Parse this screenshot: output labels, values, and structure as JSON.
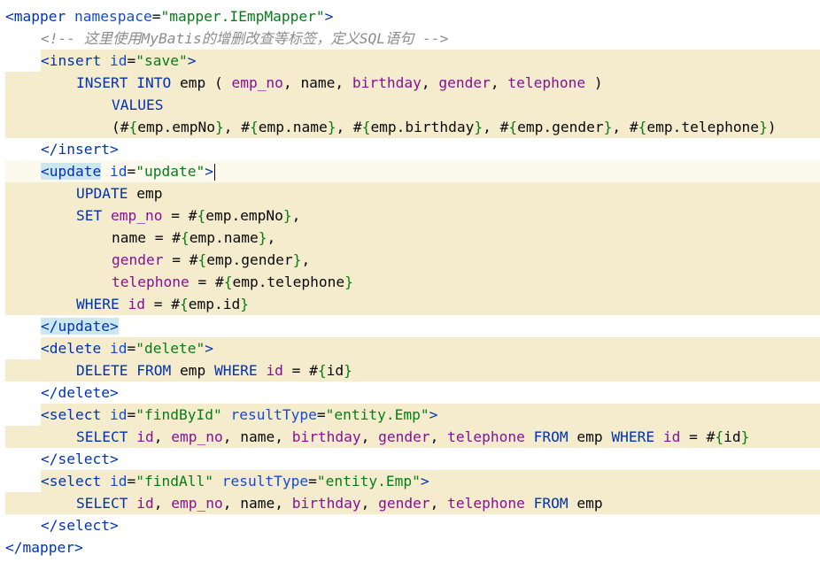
{
  "editor": {
    "lines": [
      {
        "indent": 0,
        "tokens": [
          {
            "t": "<",
            "c": "c-tag"
          },
          {
            "t": "mapper",
            "c": "c-tag"
          },
          {
            "t": " "
          },
          {
            "t": "namespace",
            "c": "c-attr"
          },
          {
            "t": "=",
            "c": "c-op"
          },
          {
            "t": "\"mapper.IEmpMapper\"",
            "c": "c-str"
          },
          {
            "t": ">",
            "c": "c-tag"
          }
        ],
        "bg": "none"
      },
      {
        "indent": 1,
        "tokens": [
          {
            "t": "<!-- 这里使用MyBatis的增删改查等标签，定义SQL语句 -->",
            "c": "c-cmt"
          }
        ],
        "bg": "none"
      },
      {
        "indent": 1,
        "tokens": [
          {
            "t": "<",
            "c": "c-tag"
          },
          {
            "t": "insert",
            "c": "c-tag"
          },
          {
            "t": " "
          },
          {
            "t": "id",
            "c": "c-attr"
          },
          {
            "t": "=",
            "c": "c-op"
          },
          {
            "t": "\"save\"",
            "c": "c-str"
          },
          {
            "t": ">",
            "c": "c-tag"
          }
        ],
        "bg": "hl",
        "bgFrom": 1
      },
      {
        "indent": 2,
        "tokens": [
          {
            "t": "INSERT INTO ",
            "c": "c-kw"
          },
          {
            "t": "emp",
            "c": "c-txt"
          },
          {
            "t": " ( ",
            "c": "c-op"
          },
          {
            "t": "emp_no",
            "c": "c-col"
          },
          {
            "t": ", ",
            "c": "c-op"
          },
          {
            "t": "name",
            "c": "c-txt"
          },
          {
            "t": ", ",
            "c": "c-op"
          },
          {
            "t": "birthday",
            "c": "c-col"
          },
          {
            "t": ", ",
            "c": "c-op"
          },
          {
            "t": "gender",
            "c": "c-col"
          },
          {
            "t": ", ",
            "c": "c-op"
          },
          {
            "t": "telephone",
            "c": "c-col"
          },
          {
            "t": " )",
            "c": "c-op"
          }
        ],
        "bg": "hl",
        "bgFrom": 0
      },
      {
        "indent": 3,
        "tokens": [
          {
            "t": "VALUES",
            "c": "c-kw"
          }
        ],
        "bg": "hl",
        "bgFrom": 0
      },
      {
        "indent": 3,
        "tokens": [
          {
            "t": "(#",
            "c": "c-op"
          },
          {
            "t": "{",
            "c": "c-brace"
          },
          {
            "t": "emp.empNo",
            "c": "c-txt"
          },
          {
            "t": "}",
            "c": "c-brace"
          },
          {
            "t": ", #",
            "c": "c-op"
          },
          {
            "t": "{",
            "c": "c-brace"
          },
          {
            "t": "emp.name",
            "c": "c-txt"
          },
          {
            "t": "}",
            "c": "c-brace"
          },
          {
            "t": ", #",
            "c": "c-op"
          },
          {
            "t": "{",
            "c": "c-brace"
          },
          {
            "t": "emp.birthday",
            "c": "c-txt"
          },
          {
            "t": "}",
            "c": "c-brace"
          },
          {
            "t": ", #",
            "c": "c-op"
          },
          {
            "t": "{",
            "c": "c-brace"
          },
          {
            "t": "emp.gender",
            "c": "c-txt"
          },
          {
            "t": "}",
            "c": "c-brace"
          },
          {
            "t": ", #",
            "c": "c-op"
          },
          {
            "t": "{",
            "c": "c-brace"
          },
          {
            "t": "emp.telephone",
            "c": "c-txt"
          },
          {
            "t": "}",
            "c": "c-brace"
          },
          {
            "t": ")",
            "c": "c-op"
          }
        ],
        "bg": "hl",
        "bgFrom": 0
      },
      {
        "indent": 1,
        "tokens": [
          {
            "t": "</",
            "c": "c-tag"
          },
          {
            "t": "insert",
            "c": "c-tag"
          },
          {
            "t": ">",
            "c": "c-tag"
          }
        ],
        "bg": "none"
      },
      {
        "indent": 1,
        "tokens": [
          {
            "t": "<",
            "c": "c-tag c-tagmatch"
          },
          {
            "t": "update",
            "c": "c-tag c-tagmatch"
          },
          {
            "t": " "
          },
          {
            "t": "id",
            "c": "c-attr"
          },
          {
            "t": "=",
            "c": "c-op"
          },
          {
            "t": "\"update\"",
            "c": "c-str"
          },
          {
            "t": ">",
            "c": "c-tag"
          }
        ],
        "bg": "cur",
        "caret": true
      },
      {
        "indent": 2,
        "tokens": [
          {
            "t": "UPDATE ",
            "c": "c-kw"
          },
          {
            "t": "emp",
            "c": "c-txt"
          }
        ],
        "bg": "hl",
        "bgFrom": 0
      },
      {
        "indent": 2,
        "tokens": [
          {
            "t": "SET ",
            "c": "c-kw"
          },
          {
            "t": "emp_no",
            "c": "c-col"
          },
          {
            "t": " = #",
            "c": "c-op"
          },
          {
            "t": "{",
            "c": "c-brace"
          },
          {
            "t": "emp.empNo",
            "c": "c-txt"
          },
          {
            "t": "}",
            "c": "c-brace"
          },
          {
            "t": ",",
            "c": "c-op"
          }
        ],
        "bg": "hl",
        "bgFrom": 0
      },
      {
        "indent": 3,
        "tokens": [
          {
            "t": "name",
            "c": "c-txt"
          },
          {
            "t": " = #",
            "c": "c-op"
          },
          {
            "t": "{",
            "c": "c-brace"
          },
          {
            "t": "emp.name",
            "c": "c-txt"
          },
          {
            "t": "}",
            "c": "c-brace"
          },
          {
            "t": ",",
            "c": "c-op"
          }
        ],
        "bg": "hl",
        "bgFrom": 0
      },
      {
        "indent": 3,
        "tokens": [
          {
            "t": "gender",
            "c": "c-col"
          },
          {
            "t": " = #",
            "c": "c-op"
          },
          {
            "t": "{",
            "c": "c-brace"
          },
          {
            "t": "emp.gender",
            "c": "c-txt"
          },
          {
            "t": "}",
            "c": "c-brace"
          },
          {
            "t": ",",
            "c": "c-op"
          }
        ],
        "bg": "hl",
        "bgFrom": 0
      },
      {
        "indent": 3,
        "tokens": [
          {
            "t": "telephone",
            "c": "c-col"
          },
          {
            "t": " = #",
            "c": "c-op"
          },
          {
            "t": "{",
            "c": "c-brace"
          },
          {
            "t": "emp.telephone",
            "c": "c-txt"
          },
          {
            "t": "}",
            "c": "c-brace"
          }
        ],
        "bg": "hl",
        "bgFrom": 0
      },
      {
        "indent": 2,
        "tokens": [
          {
            "t": "WHERE ",
            "c": "c-kw"
          },
          {
            "t": "id",
            "c": "c-col"
          },
          {
            "t": " = #",
            "c": "c-op"
          },
          {
            "t": "{",
            "c": "c-brace"
          },
          {
            "t": "emp.id",
            "c": "c-txt"
          },
          {
            "t": "}",
            "c": "c-brace"
          }
        ],
        "bg": "hl",
        "bgFrom": 0
      },
      {
        "indent": 1,
        "tokens": [
          {
            "t": "</",
            "c": "c-tag c-tagmatch"
          },
          {
            "t": "update",
            "c": "c-tag c-tagmatch"
          },
          {
            "t": ">",
            "c": "c-tag c-tagmatch"
          }
        ],
        "bg": "none"
      },
      {
        "indent": 1,
        "tokens": [
          {
            "t": "<",
            "c": "c-tag"
          },
          {
            "t": "delete",
            "c": "c-tag"
          },
          {
            "t": " "
          },
          {
            "t": "id",
            "c": "c-attr"
          },
          {
            "t": "=",
            "c": "c-op"
          },
          {
            "t": "\"delete\"",
            "c": "c-str"
          },
          {
            "t": ">",
            "c": "c-tag"
          }
        ],
        "bg": "hl",
        "bgFrom": 1
      },
      {
        "indent": 2,
        "tokens": [
          {
            "t": "DELETE FROM ",
            "c": "c-kw"
          },
          {
            "t": "emp",
            "c": "c-txt"
          },
          {
            "t": " WHERE ",
            "c": "c-kw"
          },
          {
            "t": "id",
            "c": "c-col"
          },
          {
            "t": " = #",
            "c": "c-op"
          },
          {
            "t": "{",
            "c": "c-brace"
          },
          {
            "t": "id",
            "c": "c-txt"
          },
          {
            "t": "}",
            "c": "c-brace"
          }
        ],
        "bg": "hl",
        "bgFrom": 0
      },
      {
        "indent": 1,
        "tokens": [
          {
            "t": "</",
            "c": "c-tag"
          },
          {
            "t": "delete",
            "c": "c-tag"
          },
          {
            "t": ">",
            "c": "c-tag"
          }
        ],
        "bg": "none"
      },
      {
        "indent": 1,
        "tokens": [
          {
            "t": "<",
            "c": "c-tag"
          },
          {
            "t": "select",
            "c": "c-tag"
          },
          {
            "t": " "
          },
          {
            "t": "id",
            "c": "c-attr"
          },
          {
            "t": "=",
            "c": "c-op"
          },
          {
            "t": "\"findById\"",
            "c": "c-str"
          },
          {
            "t": " "
          },
          {
            "t": "resultType",
            "c": "c-attr"
          },
          {
            "t": "=",
            "c": "c-op"
          },
          {
            "t": "\"entity.Emp\"",
            "c": "c-str"
          },
          {
            "t": ">",
            "c": "c-tag"
          }
        ],
        "bg": "hl",
        "bgFrom": 1
      },
      {
        "indent": 2,
        "tokens": [
          {
            "t": "SELECT ",
            "c": "c-kw"
          },
          {
            "t": "id",
            "c": "c-col"
          },
          {
            "t": ", ",
            "c": "c-op"
          },
          {
            "t": "emp_no",
            "c": "c-col"
          },
          {
            "t": ", ",
            "c": "c-op"
          },
          {
            "t": "name",
            "c": "c-txt"
          },
          {
            "t": ", ",
            "c": "c-op"
          },
          {
            "t": "birthday",
            "c": "c-col"
          },
          {
            "t": ", ",
            "c": "c-op"
          },
          {
            "t": "gender",
            "c": "c-col"
          },
          {
            "t": ", ",
            "c": "c-op"
          },
          {
            "t": "telephone",
            "c": "c-col"
          },
          {
            "t": " FROM ",
            "c": "c-kw"
          },
          {
            "t": "emp",
            "c": "c-txt"
          },
          {
            "t": " WHERE ",
            "c": "c-kw"
          },
          {
            "t": "id",
            "c": "c-col"
          },
          {
            "t": " = #",
            "c": "c-op"
          },
          {
            "t": "{",
            "c": "c-brace"
          },
          {
            "t": "id",
            "c": "c-txt"
          },
          {
            "t": "}",
            "c": "c-brace"
          }
        ],
        "bg": "hl",
        "bgFrom": 0
      },
      {
        "indent": 1,
        "tokens": [
          {
            "t": "</",
            "c": "c-tag"
          },
          {
            "t": "select",
            "c": "c-tag"
          },
          {
            "t": ">",
            "c": "c-tag"
          }
        ],
        "bg": "none"
      },
      {
        "indent": 1,
        "tokens": [
          {
            "t": "<",
            "c": "c-tag"
          },
          {
            "t": "select",
            "c": "c-tag"
          },
          {
            "t": " "
          },
          {
            "t": "id",
            "c": "c-attr"
          },
          {
            "t": "=",
            "c": "c-op"
          },
          {
            "t": "\"findAll\"",
            "c": "c-str"
          },
          {
            "t": " "
          },
          {
            "t": "resultType",
            "c": "c-attr"
          },
          {
            "t": "=",
            "c": "c-op"
          },
          {
            "t": "\"entity.Emp\"",
            "c": "c-str"
          },
          {
            "t": ">",
            "c": "c-tag"
          }
        ],
        "bg": "hl",
        "bgFrom": 1
      },
      {
        "indent": 2,
        "tokens": [
          {
            "t": "SELECT ",
            "c": "c-kw"
          },
          {
            "t": "id",
            "c": "c-col"
          },
          {
            "t": ", ",
            "c": "c-op"
          },
          {
            "t": "emp_no",
            "c": "c-col"
          },
          {
            "t": ", ",
            "c": "c-op"
          },
          {
            "t": "name",
            "c": "c-txt"
          },
          {
            "t": ", ",
            "c": "c-op"
          },
          {
            "t": "birthday",
            "c": "c-col"
          },
          {
            "t": ", ",
            "c": "c-op"
          },
          {
            "t": "gender",
            "c": "c-col"
          },
          {
            "t": ", ",
            "c": "c-op"
          },
          {
            "t": "telephone",
            "c": "c-col"
          },
          {
            "t": " FROM ",
            "c": "c-kw"
          },
          {
            "t": "emp",
            "c": "c-txt"
          }
        ],
        "bg": "hl",
        "bgFrom": 0
      },
      {
        "indent": 1,
        "tokens": [
          {
            "t": "</",
            "c": "c-tag"
          },
          {
            "t": "select",
            "c": "c-tag"
          },
          {
            "t": ">",
            "c": "c-tag"
          }
        ],
        "bg": "none"
      },
      {
        "indent": 0,
        "tokens": [
          {
            "t": "</",
            "c": "c-tag"
          },
          {
            "t": "mapper",
            "c": "c-tag"
          },
          {
            "t": ">",
            "c": "c-tag"
          }
        ],
        "bg": "none"
      }
    ]
  },
  "colors": {
    "background": "#ffffff",
    "injected_sql_background": "#f5eccd",
    "current_line": "#fcfaed",
    "tag_match": "#cce8ee",
    "xml_tag": "#0033b3",
    "attribute_value": "#067d17",
    "sql_column": "#871094",
    "comment": "#8c8c8c"
  }
}
